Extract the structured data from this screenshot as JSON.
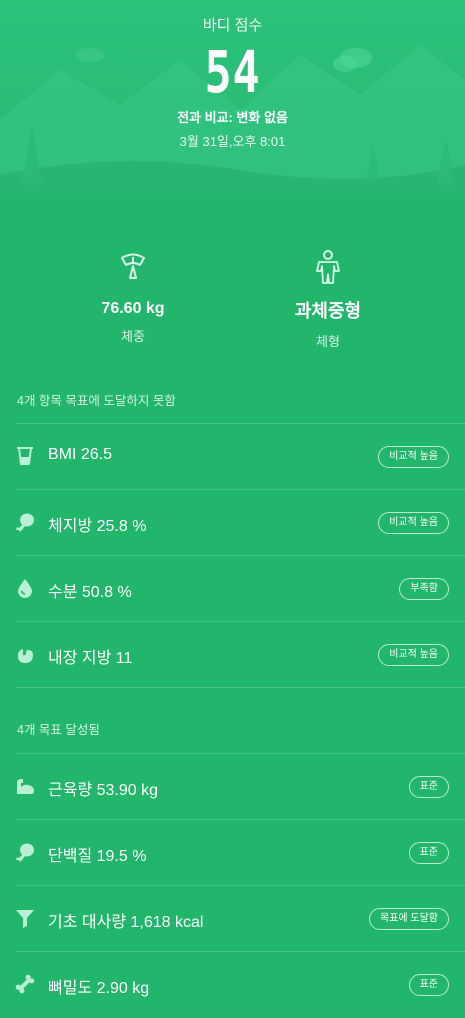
{
  "header": {
    "title": "바디 점수",
    "score": "54",
    "comparison": "전과 비교: 변화 없음",
    "datetime": "3월 31일,오후 8:01"
  },
  "stats": {
    "weight_value": "76.60 kg",
    "weight_label": "체중",
    "body_type_value": "과체중형",
    "body_type_label": "체형"
  },
  "sections": {
    "not_reached": "4개 항목 목표에 도달하지 못함",
    "reached": "4개 목표 달성됨"
  },
  "metrics_not_reached": [
    {
      "icon": "beaker-icon",
      "label": "BMI 26.5",
      "badge": "비교적 높음"
    },
    {
      "icon": "drumstick-icon",
      "label": "체지방 25.8 %",
      "badge": "비교적 높음"
    },
    {
      "icon": "water-drop-icon",
      "label": "수분 50.8 %",
      "badge": "부족함"
    },
    {
      "icon": "stomach-icon",
      "label": "내장 지방 11",
      "badge": "비교적 높음"
    }
  ],
  "metrics_reached": [
    {
      "icon": "muscle-arm-icon",
      "label": "근육량 53.90 kg",
      "badge": "표준"
    },
    {
      "icon": "drumstick-icon",
      "label": "단백질 19.5 %",
      "badge": "표준"
    },
    {
      "icon": "funnel-icon",
      "label": "기초 대사량 1,618 kcal",
      "badge": "목표에 도달함"
    },
    {
      "icon": "bone-icon",
      "label": "뼈밀도 2.90 kg",
      "badge": "표준"
    }
  ],
  "colors": {
    "background": "#22b56c",
    "hero_light": "#3ccf86",
    "hero_dark": "#1fa862",
    "icon_fill": "#b9f0d5"
  }
}
